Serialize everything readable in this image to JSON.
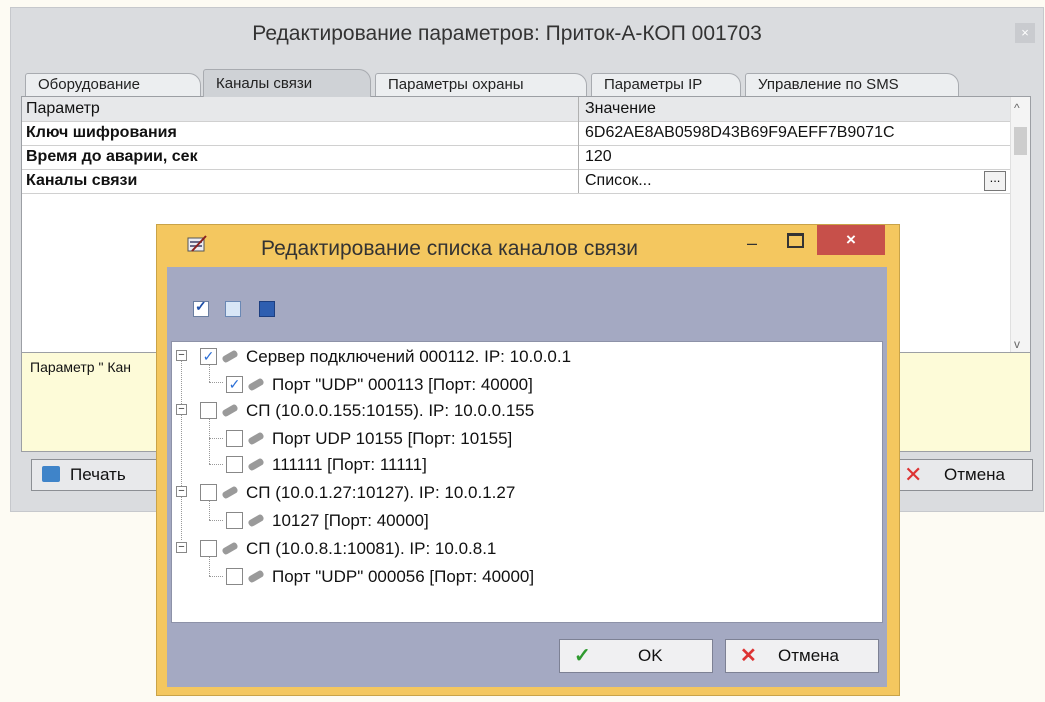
{
  "main_window": {
    "title": "Редактирование параметров: Приток-А-КОП 001703",
    "close_symbol": "×"
  },
  "tabs": [
    {
      "label": "Оборудование"
    },
    {
      "label": "Каналы связи"
    },
    {
      "label": "Параметры охраны"
    },
    {
      "label": "Параметры IP"
    },
    {
      "label": "Управление по SMS"
    }
  ],
  "grid": {
    "header": {
      "param": "Параметр",
      "value": "Значение"
    },
    "rows": [
      {
        "param": "Ключ шифрования",
        "value": "6D62AE8AB0598D43B69F9AEFF7B9071C"
      },
      {
        "param": "Время до аварии, сек",
        "value": "120"
      },
      {
        "param": "Каналы связи",
        "value": "Список...",
        "button": "..."
      }
    ]
  },
  "description": {
    "text": "Параметр \" Кан"
  },
  "main_buttons": {
    "print": "Печать",
    "cancel": "Отмена"
  },
  "dialog": {
    "title": "Редактирование списка каналов связи",
    "close_symbol": "×",
    "tree": [
      {
        "label": "Сервер подключений 000112. IP: 10.0.0.1",
        "checked": true,
        "checkmark": "✓",
        "expander": "−"
      },
      {
        "label": "Порт \"UDP\" 000113 [Порт: 40000]",
        "checked": true,
        "checkmark": "✓"
      },
      {
        "label": "СП (10.0.0.155:10155). IP: 10.0.0.155",
        "checked": false,
        "expander": "−"
      },
      {
        "label": "Порт UDP 10155 [Порт: 10155]",
        "checked": false
      },
      {
        "label": "111111 [Порт: 11111]",
        "checked": false
      },
      {
        "label": "СП (10.0.1.27:10127). IP: 10.0.1.27",
        "checked": false,
        "expander": "−"
      },
      {
        "label": "10127 [Порт: 40000]",
        "checked": false
      },
      {
        "label": "СП (10.0.8.1:10081). IP: 10.0.8.1",
        "checked": false,
        "expander": "−"
      },
      {
        "label": "Порт \"UDP\" 000056 [Порт: 40000]",
        "checked": false
      }
    ],
    "buttons": {
      "ok": "OK",
      "cancel": "Отмена"
    }
  },
  "icons": {
    "select_all": "✓",
    "check": "✓",
    "cross": "✕"
  }
}
